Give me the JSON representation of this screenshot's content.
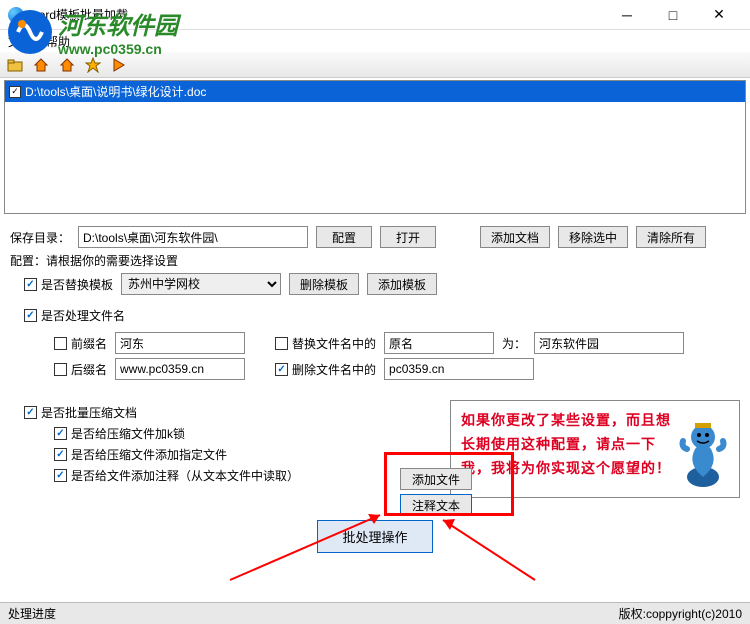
{
  "window": {
    "title": "word模板批量加载"
  },
  "menu": {
    "file": "文件",
    "help": "帮助"
  },
  "filelist": {
    "item0": "D:\\tools\\桌面\\说明书\\绿化设计.doc"
  },
  "save": {
    "label": "保存目录：",
    "path": "D:\\tools\\桌面\\河东软件园\\",
    "config": "配置",
    "open": "打开",
    "addDoc": "添加文档",
    "removeSel": "移除选中",
    "clearAll": "清除所有"
  },
  "configHint": "配置：请根据你的需要选择设置",
  "template": {
    "replaceLabel": "是否替换模板",
    "selected": "苏州中学网校",
    "delete": "删除模板",
    "add": "添加模板"
  },
  "filename": {
    "processLabel": "是否处理文件名",
    "prefixLabel": "前缀名",
    "prefixVal": "河东",
    "suffixLabel": "后缀名",
    "suffixVal": "www.pc0359.cn",
    "replaceInName": "替换文件名中的",
    "origName": "原名",
    "toLabel": "为：",
    "newName": "河东软件园",
    "deleteInName": "删除文件名中的",
    "deleteVal": "pc0359.cn"
  },
  "compress": {
    "batchLabel": "是否批量压缩文档",
    "lockLabel": "是否给压缩文件加k锁",
    "addFileLabel": "是否给压缩文件添加指定文件",
    "annotLabel": "是否给文件添加注释（从文本文件中读取）",
    "addFileBtn": "添加文件",
    "annotBtn": "注释文本"
  },
  "tip": "如果你更改了某些设置，而且想长期使用这种配置，请点一下我，我将为你实现这个愿望的！",
  "batchBtn": "批处理操作",
  "status": {
    "progress": "处理进度",
    "copyright": "版权:coppyright(c)2010"
  },
  "watermark": {
    "name": "河东软件园",
    "url": "www.pc0359.cn"
  }
}
